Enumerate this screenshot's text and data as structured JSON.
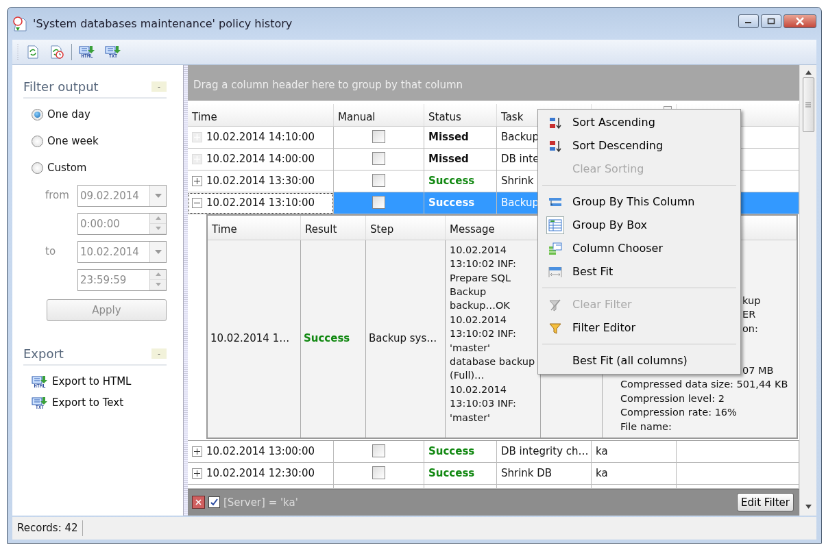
{
  "window": {
    "title": "'System databases maintenance' policy history"
  },
  "toolbar": {
    "buttons": [
      {
        "kind": "refresh"
      },
      {
        "kind": "history"
      },
      {
        "kind": "export",
        "label": "HTML"
      },
      {
        "kind": "export",
        "label": "TXT"
      }
    ]
  },
  "filter_panel": {
    "title": "Filter output",
    "collapse": "-",
    "options": [
      {
        "label": "One day",
        "selected": true
      },
      {
        "label": "One week",
        "selected": false
      },
      {
        "label": "Custom",
        "selected": false
      }
    ],
    "disabled": true,
    "from_label": "from",
    "from_date": "09.02.2014",
    "from_time": "0:00:00",
    "to_label": "to",
    "to_date": "10.02.2014",
    "to_time": "23:59:59",
    "apply": "Apply"
  },
  "export_panel": {
    "title": "Export",
    "collapse": "-",
    "items": [
      {
        "label": "Export to HTML",
        "icon_label": "HTML"
      },
      {
        "label": "Export to Text",
        "icon_label": "TXT"
      }
    ]
  },
  "grid": {
    "group_panel": "Drag a column header here to group by that column",
    "columns": [
      "Time",
      "Manual",
      "Status",
      "Task"
    ],
    "rows": [
      {
        "expandable": false,
        "expanded": false,
        "time": "10.02.2014 14:10:00",
        "manual": false,
        "status": "Missed",
        "kind": "missed",
        "task": "Backup",
        "selected": false
      },
      {
        "expandable": false,
        "expanded": false,
        "time": "10.02.2014 14:00:00",
        "manual": false,
        "status": "Missed",
        "kind": "missed",
        "task": "DB inte",
        "selected": false
      },
      {
        "expandable": true,
        "expanded": false,
        "time": "10.02.2014 13:30:00",
        "manual": false,
        "status": "Success",
        "kind": "success",
        "task": "Shrink",
        "selected": false
      },
      {
        "expandable": true,
        "expanded": true,
        "time": "10.02.2014 13:10:00",
        "manual": false,
        "status": "Success",
        "kind": "success",
        "task": "Backup",
        "selected": true,
        "detail": {
          "columns": [
            "Time",
            "Result",
            "Step",
            "Message"
          ],
          "rows": [
            {
              "time": "10.02.2014 1…",
              "result": "Success",
              "kind": "success",
              "step": "Backup sys…",
              "message": [
                "10.02.2014",
                "13:10:02 INF:",
                "Prepare SQL",
                "Backup",
                "backup…OK",
                "10.02.2014",
                "13:10:02 INF:",
                "'master'",
                "database backup",
                "(Full)…",
                "10.02.2014",
                "13:10:03 INF:",
                "'master'"
              ],
              "column_6_partial": [
                "kup",
                "ER",
                "on:"
              ],
              "column_6_partial_2": "07 MB",
              "column_6": [
                "Compressed data size: 501,44 KB",
                "Compression level: 2",
                "Compression rate: 16%",
                "File name:"
              ]
            }
          ]
        }
      },
      {
        "expandable": true,
        "expanded": false,
        "time": "10.02.2014 13:00:00",
        "manual": false,
        "status": "Success",
        "kind": "success",
        "task": "DB integrity ch…",
        "server": "ka",
        "selected": false
      },
      {
        "expandable": true,
        "expanded": false,
        "time": "10.02.2014 12:30:00",
        "manual": false,
        "status": "Success",
        "kind": "success",
        "task": "Shrink DB",
        "server": "ka",
        "selected": false
      }
    ],
    "filter_bar": {
      "enabled": true,
      "text": "[Server] = 'ka'",
      "button": "Edit Filter"
    }
  },
  "context_menu": {
    "items": [
      {
        "label": "Sort Ascending",
        "kind": "ascending",
        "disabled": false,
        "checked": false
      },
      {
        "label": "Sort Descending",
        "kind": "descending",
        "disabled": false,
        "checked": false
      },
      {
        "label": "Clear Sorting",
        "kind": "plain",
        "disabled": true,
        "checked": false
      },
      {
        "kind": "separator"
      },
      {
        "label": "Group By This Column",
        "kind": "group",
        "disabled": false,
        "checked": false
      },
      {
        "label": "Group By Box",
        "kind": "groupbox",
        "disabled": false,
        "checked": true
      },
      {
        "label": "Column Chooser",
        "kind": "chooser",
        "disabled": false,
        "checked": false
      },
      {
        "label": "Best Fit",
        "kind": "bestfit",
        "disabled": false,
        "checked": false
      },
      {
        "kind": "separator"
      },
      {
        "label": "Clear Filter",
        "kind": "clearfilter",
        "disabled": true,
        "checked": false
      },
      {
        "label": "Filter Editor",
        "kind": "filter",
        "disabled": false,
        "checked": false
      },
      {
        "kind": "separator"
      },
      {
        "label": "Best Fit (all columns)",
        "kind": "plain",
        "disabled": false,
        "checked": false
      }
    ]
  },
  "status_bar": {
    "records": "Records: 42"
  }
}
